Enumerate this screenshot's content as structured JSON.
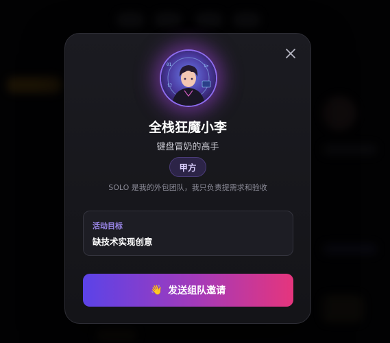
{
  "profile": {
    "name": "全栈狂魔小李",
    "subtitle": "键盘冒奶的高手",
    "badge": "甲方",
    "description": "SOLO 是我的外包团队，我只负责提需求和验收"
  },
  "goal": {
    "label": "活动目标",
    "value": "缺技术实现创意"
  },
  "actions": {
    "invite_icon": "👋",
    "invite_label": "发送组队邀请"
  },
  "icons": {
    "close": "close-icon",
    "wave": "waving-hand-icon"
  },
  "colors": {
    "accent_purple": "#9a86e8",
    "button_start": "#5b43e8",
    "button_end": "#e5357d"
  }
}
